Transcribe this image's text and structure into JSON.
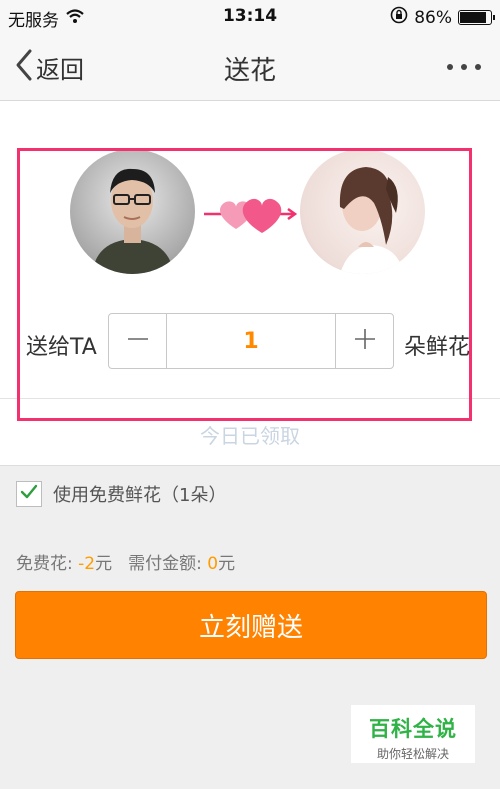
{
  "status_bar": {
    "carrier": "无服务",
    "time": "13:14",
    "battery_percent": "86%",
    "battery_level": 0.86
  },
  "nav": {
    "back_label": "返回",
    "title": "送花"
  },
  "gift": {
    "send_to_label": "送给TA",
    "quantity": "1",
    "unit_label": "朵鲜花",
    "today_note": "今日已领取"
  },
  "free_flower": {
    "checked": true,
    "label": "使用免费鲜花（1朵）"
  },
  "cost": {
    "free_label": "免费花: ",
    "free_value": "-2",
    "free_unit": "元",
    "pay_label": "需付金额: ",
    "pay_value": "0",
    "pay_unit": "元"
  },
  "send_button_label": "立刻赠送",
  "watermark": {
    "title": "百科全说",
    "subtitle": "助你轻松解决"
  },
  "colors": {
    "accent": "#ff8200",
    "highlight_border": "#f2316e",
    "amount": "#ff9c00",
    "check": "#2e9e3e"
  }
}
